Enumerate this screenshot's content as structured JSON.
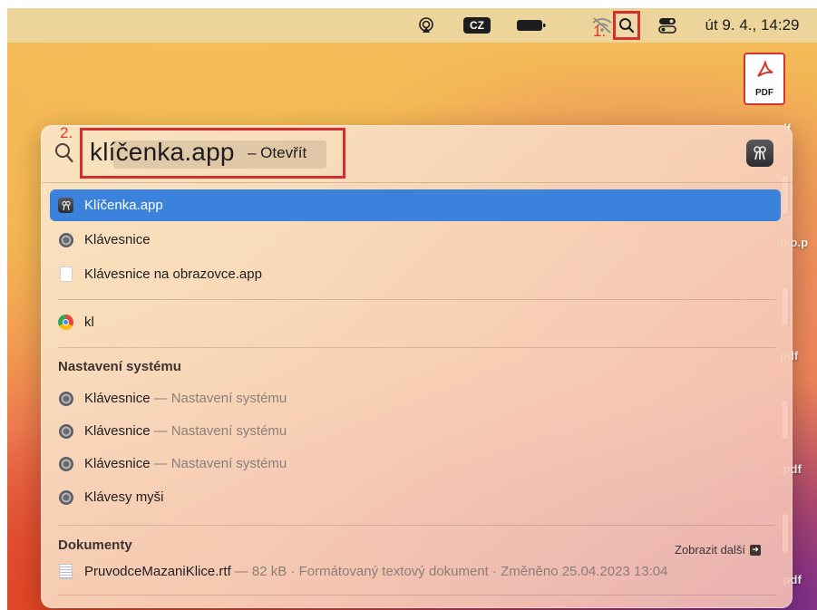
{
  "menubar": {
    "keyboard_layout": "CZ",
    "step1_label": "1.",
    "datetime": "út 9. 4., 14:29"
  },
  "desktop": {
    "pdf_icon_label": "PDF",
    "file_labels": [
      "df",
      "tko.p",
      "pdf",
      ".pdf",
      ".pdf"
    ]
  },
  "spotlight": {
    "step2_label": "2.",
    "query": "klíčenka.app",
    "query_suffix": "– Otevřít",
    "results": [
      {
        "name": "Klíčenka.app",
        "icon": "keychain-icon",
        "selected": true
      },
      {
        "name": "Klávesnice",
        "icon": "gear-icon"
      },
      {
        "name": "Klávesnice na obrazovce.app",
        "icon": "document-icon"
      },
      {
        "name": "kl",
        "icon": "chrome-icon"
      }
    ],
    "settings_section": {
      "title": "Nastavení systému",
      "items": [
        {
          "name": "Klávesnice",
          "detail": "— Nastavení systému",
          "icon": "gear-icon"
        },
        {
          "name": "Klávesnice",
          "detail": "— Nastavení systému",
          "icon": "gear-icon"
        },
        {
          "name": "Klávesnice",
          "detail": "— Nastavení systému",
          "icon": "gear-icon"
        },
        {
          "name": "Klávesy myši",
          "detail": "",
          "icon": "gear-icon"
        }
      ]
    },
    "documents_section": {
      "title": "Dokumenty",
      "show_more": "Zobrazit další",
      "items": [
        {
          "name": "PruvodceMazaniKlice.rtf",
          "detail": "— 82 kB · Formátovaný textový dokument · Změněno 25.04.2023 13:04",
          "icon": "rtf-icon"
        }
      ]
    }
  },
  "colors": {
    "highlight_border": "#d32f2f",
    "selected_row": "#3a82db",
    "step_label": "#e03a2c"
  }
}
